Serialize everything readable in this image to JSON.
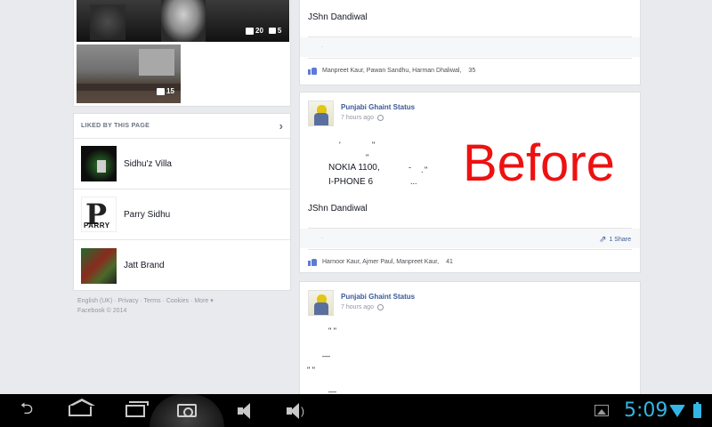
{
  "photos": [
    {
      "likes": "20",
      "comments": "5"
    },
    {
      "likes": "15"
    }
  ],
  "liked_by_page": {
    "title": "LIKED BY THIS PAGE",
    "items": [
      {
        "name": "Sidhu'z Villa"
      },
      {
        "name": "Parry Sidhu",
        "thumb_text": "PARRY"
      },
      {
        "name": "Jatt Brand"
      }
    ]
  },
  "footer": {
    "line1": "English (UK) · Privacy · Terms · Cookies · More ▾",
    "line2": "Facebook © 2014"
  },
  "posts": [
    {
      "signature": "JShn Dandiwal",
      "separator_dot": "·",
      "liked_by": "Manpreet Kaur, Pawan Sandhu, Harman Dhaliwal,",
      "likes_count": "35"
    },
    {
      "page_name": "Punjabi Ghaint Status",
      "time": "7 hours ago",
      "glyphs": [
        "'",
        "\"",
        "\"",
        "-",
        ".",
        "\"",
        "..."
      ],
      "line1": "NOKIA 1100,",
      "line2": "I-PHONE 6",
      "signature": "JShn Dandiwal",
      "separator_dot": "·",
      "share_label": "1 Share",
      "liked_by": "Harnoor Kaur, Ajmer Paul, Manpreet Kaur,",
      "likes_count": "41"
    },
    {
      "page_name": "Punjabi Ghaint Status",
      "time": "7 hours ago",
      "glyphs": [
        "\" \"",
        "—",
        "\" \"",
        "—"
      ]
    }
  ],
  "overlay_text": "Before",
  "statusbar": {
    "time": "5:09",
    "accent_color": "#33b5e5"
  },
  "icons": {
    "back": "back-arrow-icon",
    "home": "home-icon",
    "recent": "recent-apps-icon",
    "camera": "screenshot-camera-icon",
    "vol_down": "volume-down-icon",
    "vol_up": "volume-up-icon",
    "gallery": "gallery-icon",
    "wifi": "wifi-icon",
    "battery": "battery-icon"
  },
  "colors": {
    "link": "#3b5998",
    "overlay": "#ee1111",
    "background": "#e9eaed"
  }
}
